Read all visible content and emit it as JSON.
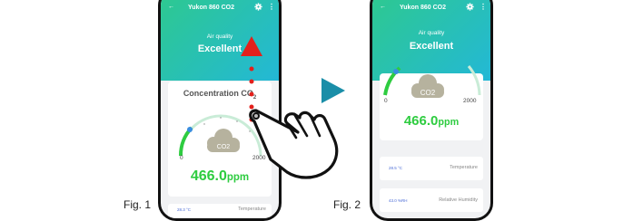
{
  "phone1": {
    "title": "Yukon 860 CO2",
    "air_quality_label": "Air quality",
    "air_quality_value": "Excellent",
    "card_title": "Concentration CO2",
    "gauge_min": "0",
    "gauge_max": "2000",
    "badge": "CO2",
    "reading_value": "466.0",
    "reading_unit": "ppm",
    "temperature_value": "28.3 °C",
    "temperature_label": "Temperature"
  },
  "phone2": {
    "title": "Yukon 860 CO2",
    "air_quality_label": "Air quality",
    "air_quality_value": "Excellent",
    "gauge_min": "0",
    "gauge_max": "2000",
    "badge": "CO2",
    "reading_value": "466.0",
    "reading_unit": "ppm",
    "temperature_value": "28.5 °C",
    "temperature_label": "Temperature",
    "humidity_value": "43.0 %RH",
    "humidity_label": "Relative Humidity"
  },
  "figures": {
    "fig1": "Fig. 1",
    "fig2": "Fig. 2"
  },
  "colors": {
    "header_start": "#2ec98e",
    "header_end": "#23b8d6",
    "reading": "#2ecc40",
    "arrow": "#e3201b",
    "next_arrow": "#1a8ea8"
  },
  "icons": {
    "back": "arrow-left-icon",
    "settings": "gear-icon",
    "more": "more-vertical-icon",
    "cloud": "cloud-icon",
    "hand": "hand-pointer-icon",
    "next": "play-triangle-icon"
  }
}
